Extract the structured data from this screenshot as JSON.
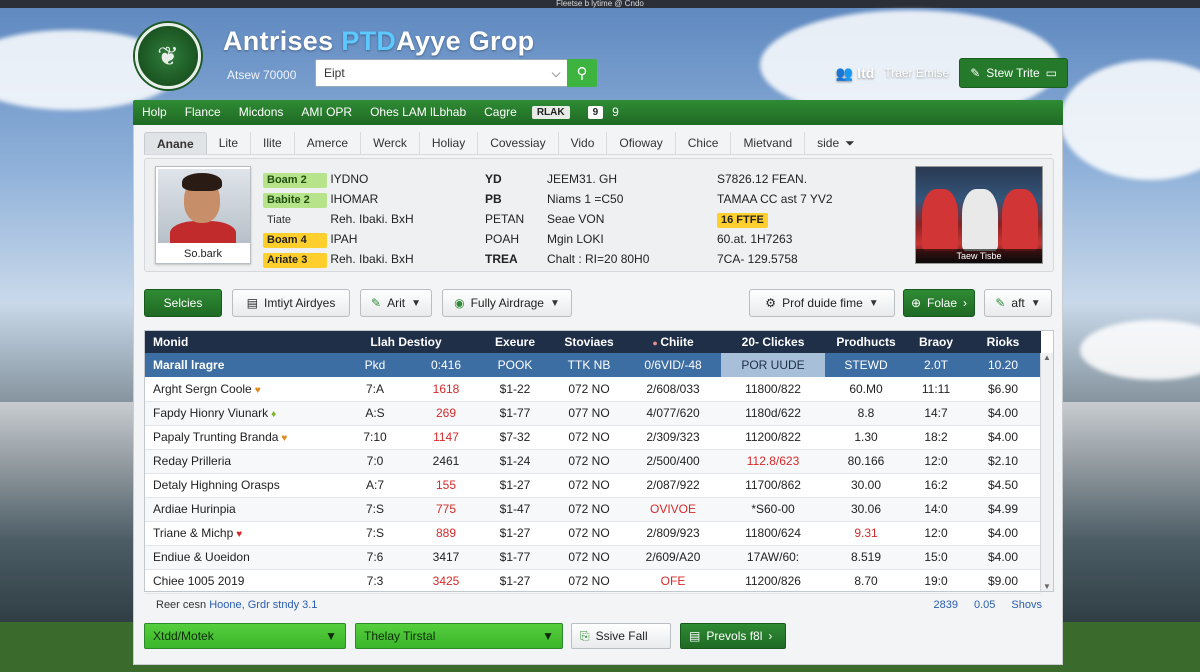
{
  "window_title": "Fleetse b lytime @ Cndo",
  "app": {
    "title_part1": "Antrises",
    "title_accent": "PTD",
    "title_part2": "Ayye Grop",
    "subtitle": "Atsew 70000"
  },
  "search": {
    "value": "Eipt",
    "placeholder": "Eipt"
  },
  "header": {
    "user": "Itd",
    "link": "Traer Emise",
    "button": "Stew Trite"
  },
  "nav": {
    "items": [
      "Holp",
      "Flance",
      "Micdons",
      "AMI OPR",
      "Ohes LAM lLbhab",
      "Cagre"
    ],
    "chip1": "RLAK",
    "chip2": "9",
    "chip3": "9"
  },
  "tabs": [
    "Anane",
    "Lite",
    "Ilite",
    "Amerce",
    "Werck",
    "Holiay",
    "Covessiay",
    "Vido",
    "Ofioway",
    "Chice",
    "Mietvand",
    "side"
  ],
  "profile": {
    "name": "So.bark",
    "col1": [
      {
        "badge": "Boam 2",
        "badge_color": "green",
        "value": "IYDNO"
      },
      {
        "badge": "Babite 2",
        "badge_color": "green",
        "value": "IHOMAR"
      },
      {
        "badge": "Tiate",
        "badge_color": "plain",
        "value": "Reh. Ibaki. BxH"
      },
      {
        "badge": "Boam 4",
        "badge_color": "yellow",
        "value": "IPAH"
      },
      {
        "badge": "Ariate 3",
        "badge_color": "yellow",
        "value": "Reh. Ibaki. BxH"
      }
    ],
    "col2": [
      {
        "key": "YD",
        "value": "JEEM31. GH"
      },
      {
        "key": "PB",
        "value": "Niams 1 =C50"
      },
      {
        "key": "PETAN",
        "value": "Seae  VON"
      },
      {
        "key": "POAH",
        "value": "Mgin  LOKI"
      },
      {
        "key": "TREA",
        "value": "Chalt : RI=20 80H0"
      }
    ],
    "col3": [
      "S7826.12  FEAN.",
      "TAMAA  CC ast 7 YV2",
      "16 FTFE",
      "60.at. 1H7263",
      "7CA- 129.5758"
    ],
    "photo_caption": "Taew Tisbe"
  },
  "toolbar": {
    "b1": "Selcies",
    "b2": "Imtiyt Airdyes",
    "b3": "Arit",
    "b4": "Fully Airdrage",
    "b5": "Prof duide fime",
    "b6": "Folae",
    "b7": "aft"
  },
  "table": {
    "headers": [
      "Monid",
      "Llah Destioy",
      "Exeure",
      "Stoviaes",
      "Chiite",
      "20- Clickes",
      "Prodhucts",
      "Braoy",
      "Rioks"
    ],
    "rows": [
      [
        "Marall lragre",
        "Pkd",
        "0:416",
        "POOK",
        "TTK NB",
        "0/6VID/-48",
        "POR UUDE",
        "STEWD",
        "2.0T",
        "10.20"
      ],
      [
        "Arght Sergn Coole",
        "7:A",
        "1618",
        "$1-22",
        "072 NO",
        "2/608/033",
        "11800/822",
        "60.M0",
        "11:11",
        "$6.90"
      ],
      [
        "Fapdy Hionry Viunark",
        "A:S",
        "269",
        "$1-77",
        "077 NO",
        "4/077/620",
        "1180d/622",
        "8.8",
        "14:7",
        "$4.00"
      ],
      [
        "Papaly Trunting Branda",
        "7:10",
        "1147",
        "$7-32",
        "072 NO",
        "2/309/323",
        "11200/822",
        "1.30",
        "18:2",
        "$4.00"
      ],
      [
        "Reday Prilleria",
        "7:0",
        "2461",
        "$1-24",
        "072 NO",
        "2/500/400",
        "112.8/623",
        "80.166",
        "12:0",
        "$2.10"
      ],
      [
        "Detaly Highning Orasps",
        "A:7",
        "155",
        "$1-27",
        "072 NO",
        "2/087/922",
        "11700/862",
        "30.00",
        "16:2",
        "$4.50"
      ],
      [
        "Ardiae Hurinpia",
        "7:S",
        "775",
        "$1-47",
        "072 NO",
        "OVIVOE",
        "*S60-00",
        "30.06",
        "14:0",
        "$4.99"
      ],
      [
        "Triane & Michp",
        "7:S",
        "889",
        "$1-27",
        "072 NO",
        "2/809/923",
        "11800/624",
        "9.31",
        "12:0",
        "$4.00"
      ],
      [
        "Endiue & Uoeidon",
        "7:6",
        "3417",
        "$1-77",
        "072 NO",
        "2/609/A20",
        "17AW/60:",
        "8.519",
        "15:0",
        "$4.00"
      ],
      [
        "Chiee 1005 2019",
        "7:3",
        "3425",
        "$1-27",
        "072 NO",
        "OFE",
        "11200/826",
        "8.70",
        "19:0",
        "$9.00"
      ]
    ]
  },
  "footer": {
    "text": "Reer cesn",
    "link": "Hoone, Grdr stndy 3.1",
    "r1": "2839",
    "r2": "0.05",
    "r3": "Shovs"
  },
  "bottom": {
    "select1": "Xtdd/Motek",
    "select2": "Thelay Tirstal",
    "btn1": "Ssive Fall",
    "btn2": "Prevols f8l"
  },
  "colors": {
    "brand_green": "#247a2a",
    "header_navy": "#1f2f48",
    "selected_row": "#3c6da3",
    "accent_red": "#d42a2a",
    "accent_yellow": "#ffcf2e"
  }
}
